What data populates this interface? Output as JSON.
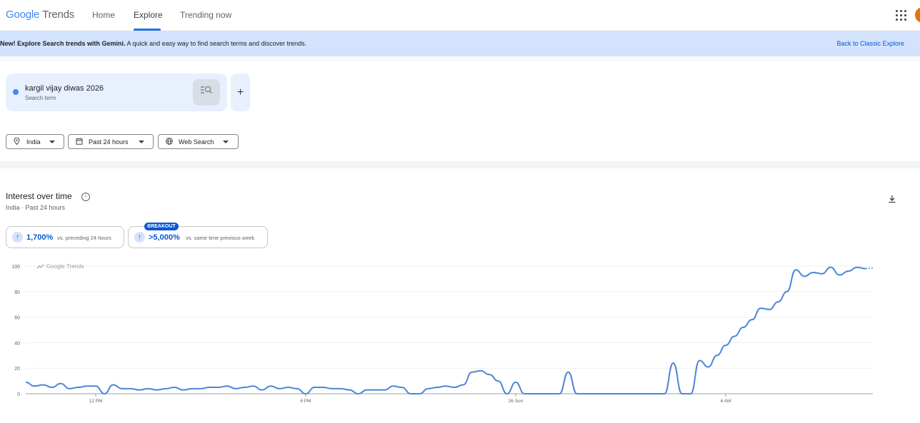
{
  "header": {
    "logo_google": "Google",
    "logo_trends": "Trends",
    "nav": [
      {
        "label": "Home",
        "active": false
      },
      {
        "label": "Explore",
        "active": true
      },
      {
        "label": "Trending now",
        "active": false
      }
    ]
  },
  "banner": {
    "bold": "New! Explore Search trends with Gemini.",
    "text": " A quick and easy way to find search terms and discover trends.",
    "link": "Back to Classic Explore"
  },
  "search": {
    "term": "kargil vijay diwas 2026",
    "type": "Search term",
    "color": "#4285f4"
  },
  "filters": {
    "region": "India",
    "time": "Past 24 hours",
    "property": "Web Search"
  },
  "interest": {
    "title": "Interest over time",
    "subtitle": "India · Past 24 hours",
    "stats": [
      {
        "value": "1,700%",
        "label": "vs. preceding 24 hours"
      },
      {
        "value": ">5,000%",
        "label": "vs. same time previous week",
        "badge": "BREAKOUT"
      }
    ]
  },
  "chart_data": {
    "type": "line",
    "watermark": "Google Trends",
    "ylim": [
      0,
      100
    ],
    "yticks": [
      0,
      20,
      40,
      60,
      80,
      100
    ],
    "xticks": [
      {
        "label": "12 PM",
        "x": 8
      },
      {
        "label": "6 PM",
        "x": 32
      },
      {
        "label": "26 Sun",
        "x": 56
      },
      {
        "label": "6 AM",
        "x": 80
      }
    ],
    "xlim": [
      0,
      96
    ],
    "series": [
      {
        "color": "#4a86d8",
        "x": [
          0,
          1,
          2,
          3,
          4,
          5,
          6,
          7,
          8,
          9,
          10,
          11,
          12,
          13,
          14,
          15,
          16,
          17,
          18,
          19,
          20,
          21,
          22,
          23,
          24,
          25,
          26,
          27,
          28,
          29,
          30,
          31,
          32,
          33,
          34,
          35,
          36,
          37,
          38,
          39,
          40,
          41,
          42,
          43,
          44,
          45,
          46,
          47,
          48,
          49,
          50,
          51,
          52,
          53,
          54,
          55,
          56,
          57,
          58,
          59,
          60,
          61,
          62,
          63,
          64,
          65,
          66,
          67,
          68,
          69,
          70,
          71,
          72,
          73,
          74,
          75,
          76,
          77,
          78,
          79,
          80,
          81,
          82,
          83,
          84,
          85,
          86,
          87,
          88,
          89,
          90,
          91,
          92,
          93,
          94,
          95,
          96
        ],
        "y": [
          9,
          6,
          7,
          5,
          8,
          4,
          5,
          6,
          6,
          0,
          7,
          4,
          4,
          3,
          4,
          3,
          4,
          5,
          3,
          4,
          4,
          5,
          5,
          6,
          4,
          5,
          6,
          3,
          6,
          4,
          5,
          4,
          0,
          5,
          5,
          4,
          4,
          3,
          0,
          3,
          3,
          3,
          6,
          5,
          0,
          0,
          4,
          5,
          6,
          5,
          7,
          17,
          18,
          15,
          10,
          0,
          9,
          0,
          0,
          0,
          0,
          0,
          17,
          0,
          0,
          0,
          0,
          0,
          0,
          0,
          0,
          0,
          0,
          0,
          24,
          0,
          0,
          26,
          21,
          30,
          38,
          45,
          52,
          58,
          67,
          66,
          72,
          80,
          97,
          92,
          95,
          94,
          99,
          93,
          96,
          99,
          98
        ]
      }
    ]
  }
}
